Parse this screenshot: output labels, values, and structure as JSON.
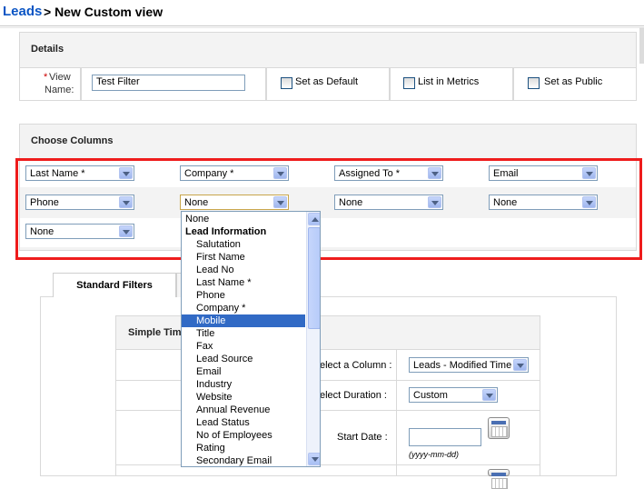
{
  "header": {
    "module": "Leads",
    "rest": "> New Custom view"
  },
  "details": {
    "title": "Details",
    "view_name_star": "*",
    "view_name_label_1": "View",
    "view_name_label_2": "Name:",
    "view_name_value": "Test Filter",
    "set_default": "Set as Default",
    "list_metrics": "List in Metrics",
    "set_public": "Set as Public"
  },
  "columns": {
    "title": "Choose Columns",
    "row1": [
      "Last Name *",
      "Company *",
      "Assigned To *",
      "Email"
    ],
    "row2": [
      "Phone",
      "None",
      "None",
      "None"
    ],
    "row3": [
      "None"
    ]
  },
  "tabs": {
    "standard": "Standard Filters"
  },
  "simple_time": {
    "title": "Simple Tim",
    "select_column_label": "elect a Column :",
    "select_column_value": "Leads - Modified Time",
    "select_duration_label": "elect Duration :",
    "select_duration_value": "Custom",
    "start_date_label": "Start Date :",
    "date_format": "(yyyy-mm-dd)"
  },
  "dropdown": {
    "items": [
      {
        "label": "None",
        "kind": "plain"
      },
      {
        "label": "Lead Information",
        "kind": "group"
      },
      {
        "label": "Salutation",
        "kind": "opt"
      },
      {
        "label": "First Name",
        "kind": "opt"
      },
      {
        "label": "Lead No",
        "kind": "opt"
      },
      {
        "label": "Last Name *",
        "kind": "opt"
      },
      {
        "label": "Phone",
        "kind": "opt"
      },
      {
        "label": "Company *",
        "kind": "opt"
      },
      {
        "label": "Mobile",
        "kind": "selected"
      },
      {
        "label": "Title",
        "kind": "opt"
      },
      {
        "label": "Fax",
        "kind": "opt"
      },
      {
        "label": "Lead Source",
        "kind": "opt"
      },
      {
        "label": "Email",
        "kind": "opt"
      },
      {
        "label": "Industry",
        "kind": "opt"
      },
      {
        "label": "Website",
        "kind": "opt"
      },
      {
        "label": "Annual Revenue",
        "kind": "opt"
      },
      {
        "label": "Lead Status",
        "kind": "opt"
      },
      {
        "label": "No of Employees",
        "kind": "opt"
      },
      {
        "label": "Rating",
        "kind": "opt"
      },
      {
        "label": "Secondary Email",
        "kind": "opt"
      }
    ]
  },
  "colors": {
    "accent": "#0b55c4",
    "highlight": "#ee1c1c",
    "selection": "#316ac5"
  }
}
